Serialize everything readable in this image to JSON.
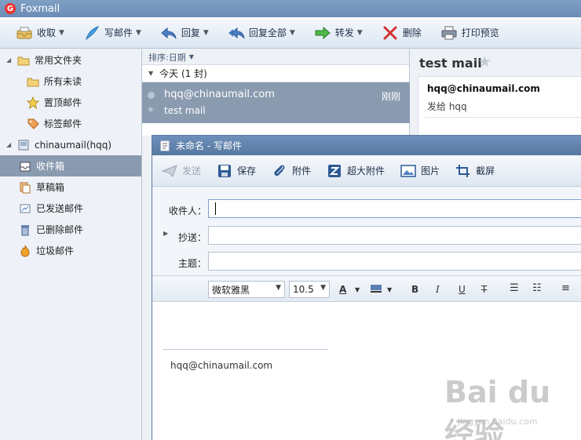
{
  "app": {
    "title": "Foxmail"
  },
  "toolbar": [
    {
      "label": "收取",
      "icon": "inbox-tray-icon",
      "dropdown": true
    },
    {
      "label": "写邮件",
      "icon": "feather-pen-icon",
      "dropdown": true
    },
    {
      "label": "回复",
      "icon": "reply-arrow-icon",
      "dropdown": true
    },
    {
      "label": "回复全部",
      "icon": "reply-all-arrow-icon",
      "dropdown": true
    },
    {
      "label": "转发",
      "icon": "forward-arrow-icon",
      "dropdown": true
    },
    {
      "label": "删除",
      "icon": "delete-x-icon",
      "dropdown": false
    },
    {
      "label": "打印预览",
      "icon": "printer-icon",
      "dropdown": false
    }
  ],
  "sidebar": {
    "common_label": "常用文件夹",
    "common_items": [
      "所有未读",
      "置顶邮件",
      "标签邮件"
    ],
    "account_label": "chinaumail(hqq)",
    "account_items": [
      "收件箱",
      "草稿箱",
      "已发送邮件",
      "已删除邮件",
      "垃圾邮件"
    ],
    "selected": "收件箱"
  },
  "list": {
    "sort_label": "排序:日期",
    "group_label": "今天 (1 封)",
    "row": {
      "from": "hqq@chinaumail.com",
      "time": "刚刚",
      "subject": "test mail"
    }
  },
  "preview": {
    "title": "test mail",
    "from": "hqq@chinaumail.com",
    "to_line": "发给 hqq"
  },
  "compose": {
    "title": "未命名 - 写邮件",
    "toolbar": [
      {
        "label": "发送",
        "icon": "send-paper-plane-icon",
        "disabled": true
      },
      {
        "label": "保存",
        "icon": "save-floppy-icon",
        "disabled": false
      },
      {
        "label": "附件",
        "icon": "paperclip-icon",
        "disabled": false
      },
      {
        "label": "超大附件",
        "icon": "large-attachment-icon",
        "disabled": false
      },
      {
        "label": "图片",
        "icon": "picture-icon",
        "disabled": false
      },
      {
        "label": "截屏",
        "icon": "screenshot-crop-icon",
        "disabled": false
      }
    ],
    "to_label": "收件人：",
    "cc_label": "抄送：",
    "subject_label": "主题：",
    "to_value": "",
    "cc_value": "",
    "subject_value": "",
    "font_name": "微软雅黑",
    "font_size": "10.5",
    "signature": "hqq@chinaumail.com"
  },
  "watermark": {
    "text": "Bai du 经验",
    "url_text": "jingyan.baidu.com"
  }
}
